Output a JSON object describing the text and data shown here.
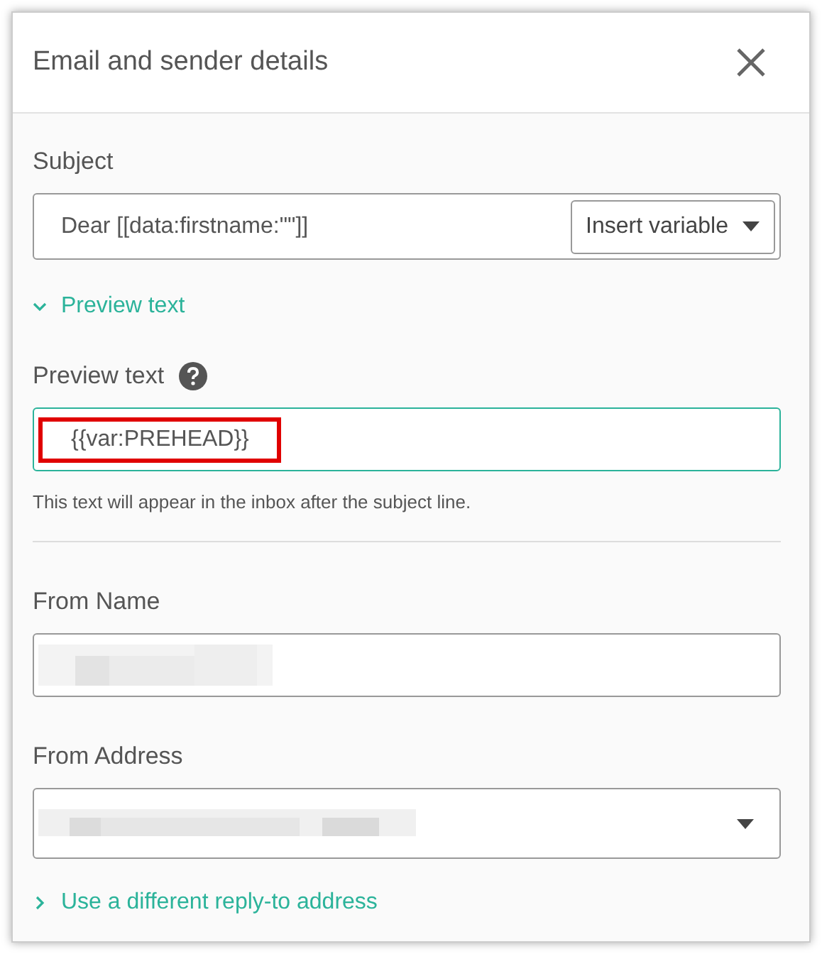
{
  "dialog": {
    "title": "Email and sender details"
  },
  "subject": {
    "label": "Subject",
    "value": "Dear [[data:firstname:\"\"]]",
    "insert_button": "Insert variable"
  },
  "preview_toggle": {
    "label": "Preview text",
    "expanded": true
  },
  "preview": {
    "label": "Preview text",
    "value": "{{var:PREHEAD}}",
    "focused": true,
    "highlighted": true,
    "hint": "This text will appear in the inbox after the subject line."
  },
  "from_name": {
    "label": "From Name",
    "redacted": true
  },
  "from_address": {
    "label": "From Address",
    "redacted": true
  },
  "reply_toggle": {
    "label": "Use a different reply-to address",
    "expanded": false
  }
}
